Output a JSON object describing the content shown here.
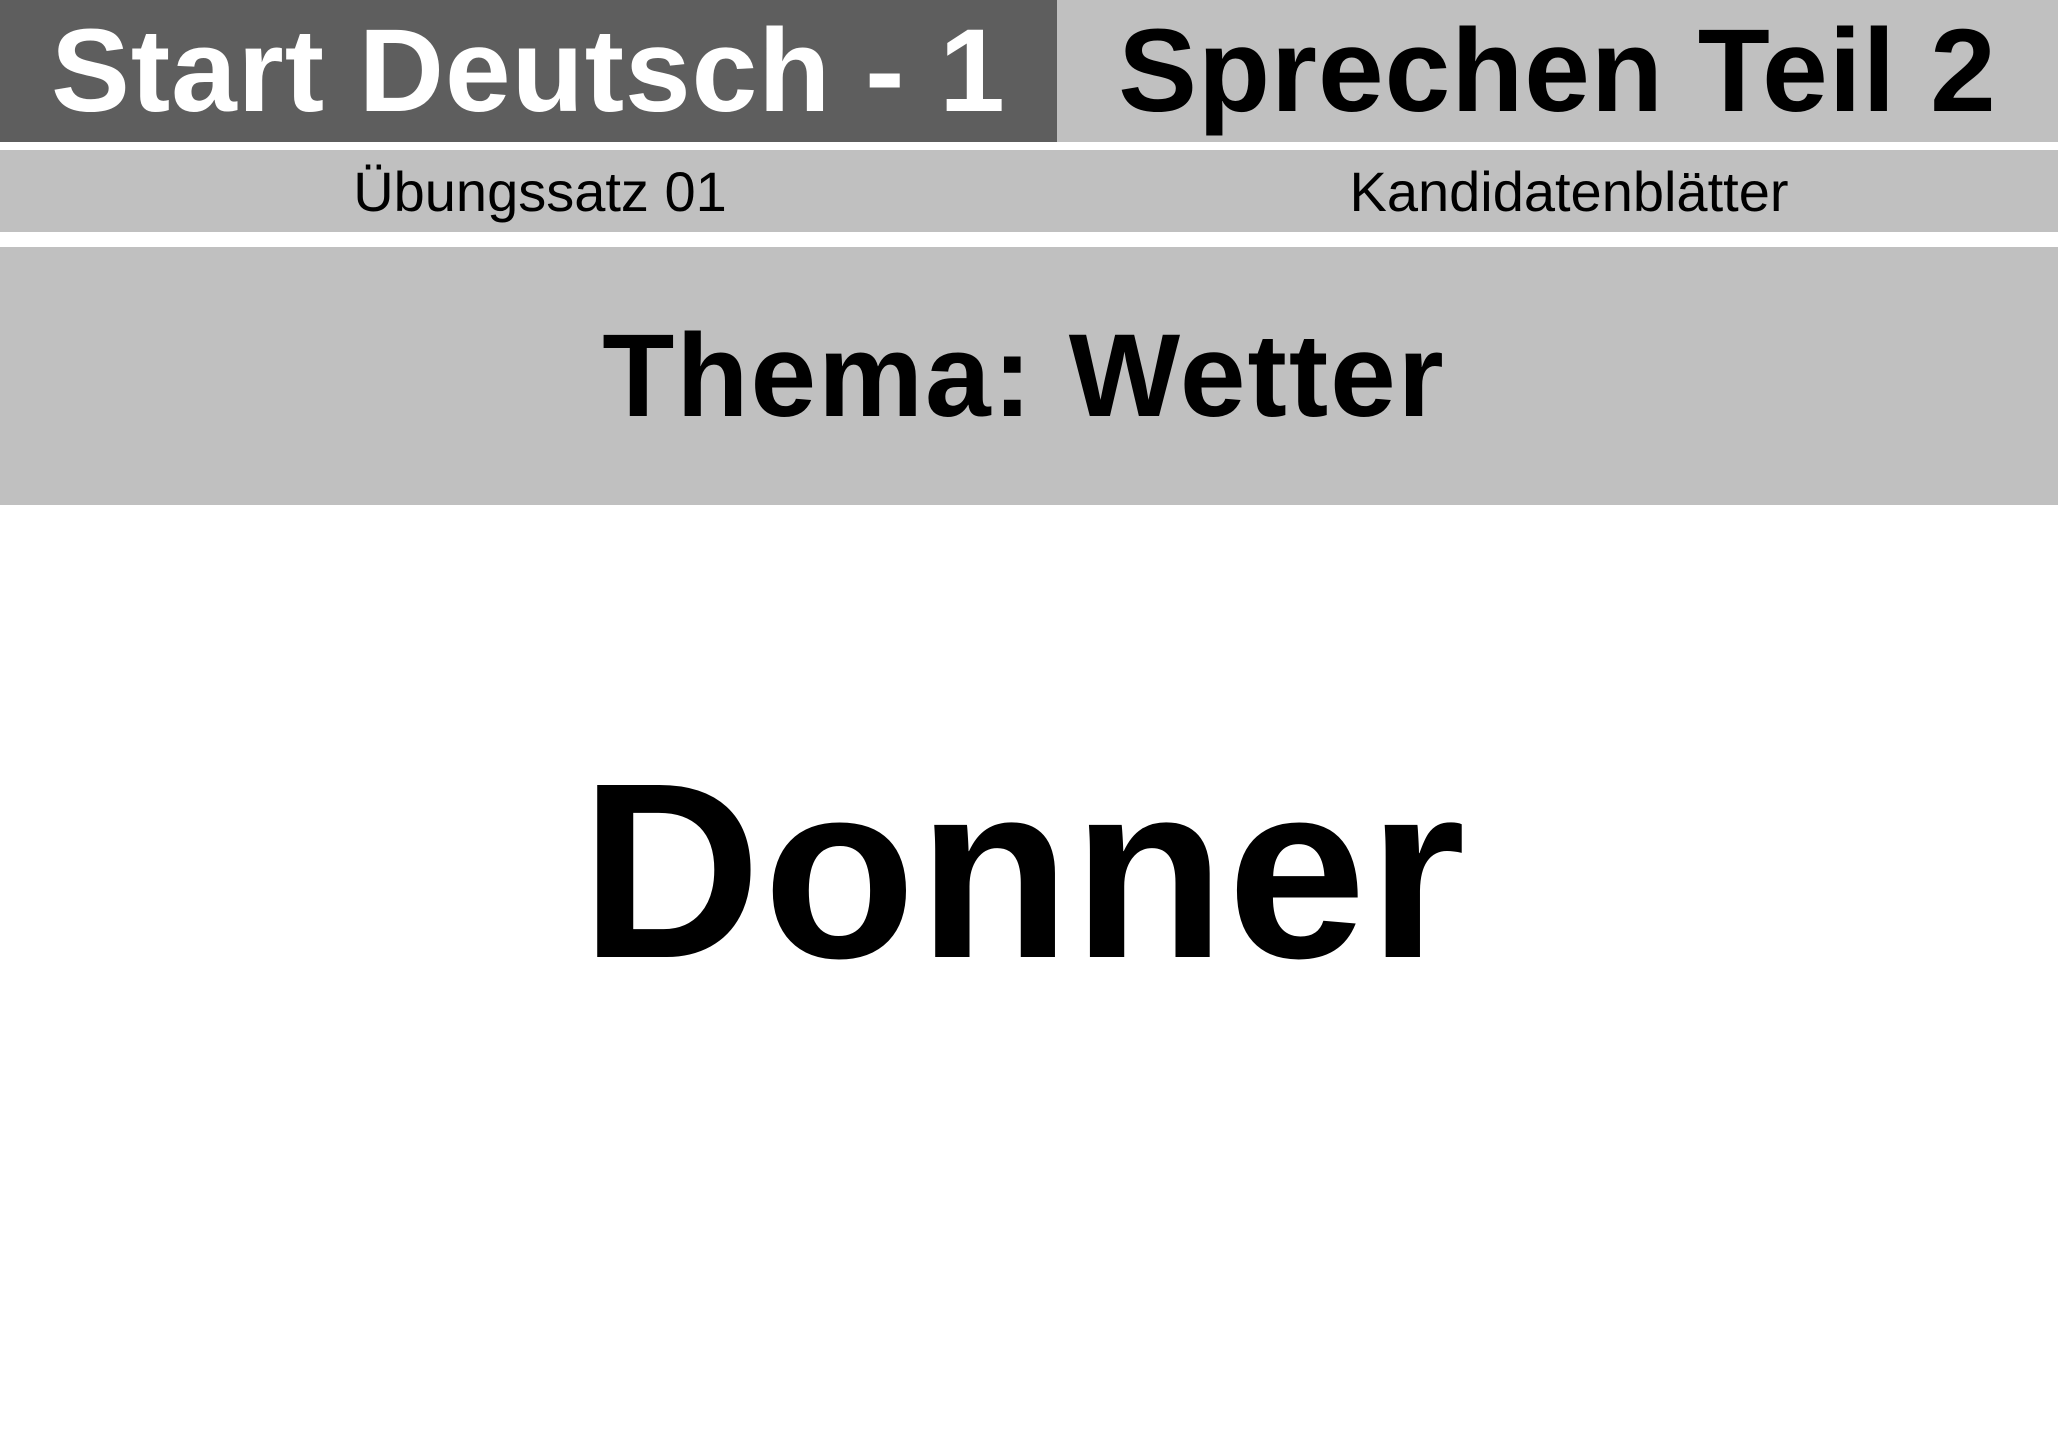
{
  "header": {
    "left_title": "Start Deutsch - 1",
    "right_title": "Sprechen Teil 2"
  },
  "subheader": {
    "left": "Übungssatz 01",
    "right": "Kandidatenblätter"
  },
  "topic": "Thema: Wetter",
  "word": "Donner",
  "colors": {
    "dark_band": "#5e5e5e",
    "light_band": "#c0c0c0",
    "background": "#ffffff"
  }
}
